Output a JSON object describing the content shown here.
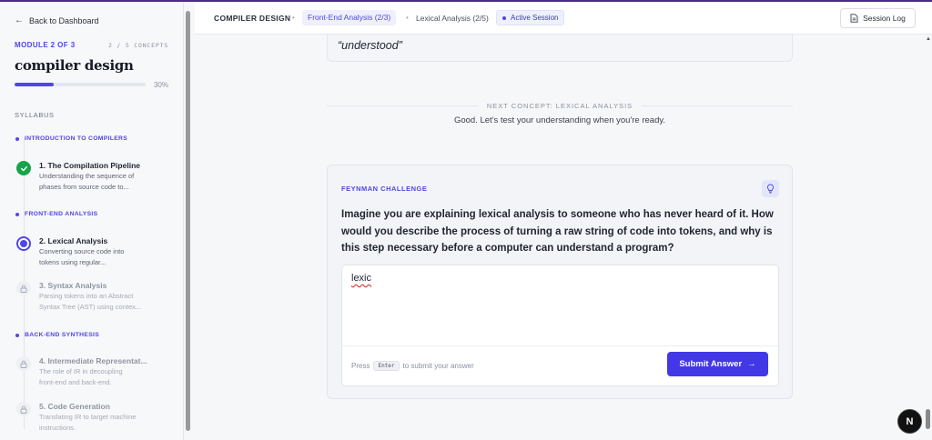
{
  "sidebar": {
    "back_label": "Back to Dashboard",
    "module_label": "MODULE 2 OF 3",
    "concepts_count": "2 / 5 CONCEPTS",
    "course_title": "compiler design",
    "progress_value": 30,
    "progress_pct": "30%",
    "syllabus_label": "SYLLABUS",
    "sections": [
      {
        "label": "INTRODUCTION TO COMPILERS",
        "items": [
          {
            "title": "1. The Compilation Pipeline",
            "desc1": "Understanding the sequence of",
            "desc2": "phases from source code to...",
            "status": "done"
          }
        ]
      },
      {
        "label": "FRONT-END ANALYSIS",
        "items": [
          {
            "title": "2. Lexical Analysis",
            "desc1": "Converting source code into",
            "desc2": "tokens using regular...",
            "status": "current"
          },
          {
            "title": "3. Syntax Analysis",
            "desc1": "Parsing tokens into an Abstract",
            "desc2": "Syntax Tree (AST) using contex...",
            "status": "locked"
          }
        ]
      },
      {
        "label": "BACK-END SYNTHESIS",
        "items": [
          {
            "title": "4. Intermediate Representat...",
            "desc1": "The role of IR in decoupling",
            "desc2": "front-end and back-end.",
            "status": "locked"
          },
          {
            "title": "5. Code Generation",
            "desc1": "Translating IR to target machine",
            "desc2": "instructions.",
            "status": "locked"
          }
        ]
      }
    ]
  },
  "header": {
    "course": "COMPILER DESIGN",
    "module_crumb": "Front-End Analysis (2/3)",
    "concept_crumb": "Lexical Analysis (2/5)",
    "session_status": "Active Session",
    "log_button": "Session Log"
  },
  "main": {
    "quote_text": "“understood”",
    "next_concept_label": "NEXT CONCEPT: LEXICAL ANALYSIS",
    "next_concept_msg": "Good. Let's test your understanding when you're ready.",
    "challenge": {
      "label": "FEYNMAN CHALLENGE",
      "question": "Imagine you are explaining lexical analysis to someone who has never heard of it. How would you describe the process of turning a raw string of code into tokens, and why is this step necessary before a computer can understand a program?",
      "answer_value": "lexic",
      "hint_press": "Press",
      "hint_key": "Enter",
      "hint_rest": "to submit your answer",
      "submit_label": "Submit Answer"
    }
  },
  "avatar_letter": "N",
  "colors": {
    "accent": "#4f46e5",
    "done": "#16a34a",
    "submit": "#4338e6"
  }
}
